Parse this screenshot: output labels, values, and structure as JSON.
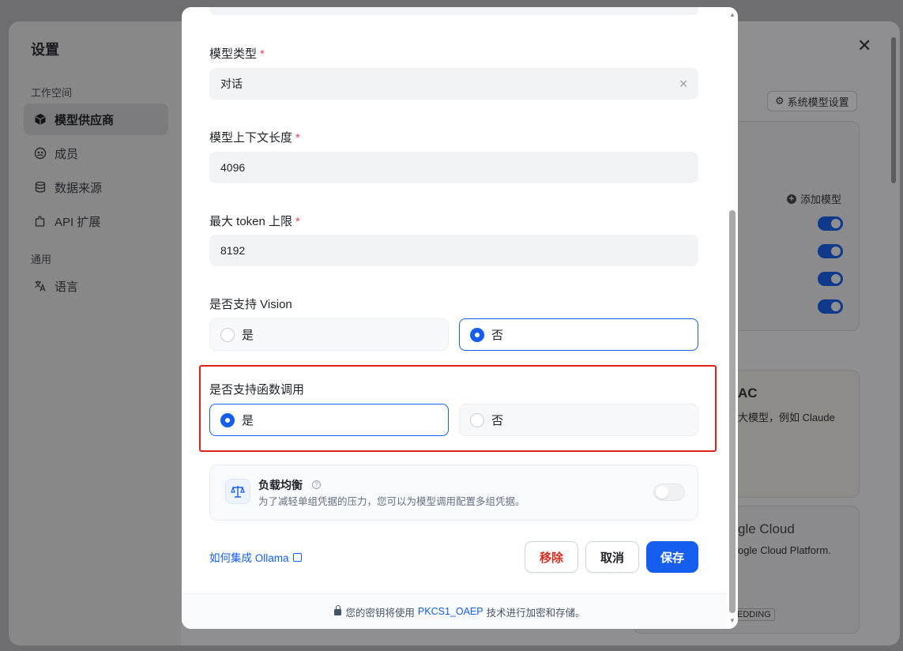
{
  "background": {
    "title": "设置",
    "workspace_label": "工作空间",
    "nav_items": [
      {
        "label": "模型供应商",
        "icon": "cube-icon",
        "active": true
      },
      {
        "label": "成员",
        "icon": "members-icon",
        "active": false
      },
      {
        "label": "数据来源",
        "icon": "database-icon",
        "active": false
      },
      {
        "label": "API 扩展",
        "icon": "puzzle-icon",
        "active": false
      }
    ],
    "general_label": "通用",
    "language_item": "语言",
    "close": "✕",
    "system_model_settings": "系统模型设置",
    "add_model": "添加模型",
    "peek_ac": "AC",
    "peek_claude": "大模型，例如 Claude",
    "peek_gcloud": "gle Cloud",
    "peek_gcp": "ogle Cloud Platform.",
    "peek_embedding": "EDDING"
  },
  "modal": {
    "model_type": {
      "label": "模型类型",
      "required": "*",
      "value": "对话"
    },
    "context_length": {
      "label": "模型上下文长度",
      "required": "*",
      "value": "4096"
    },
    "max_tokens": {
      "label": "最大 token 上限",
      "required": "*",
      "value": "8192"
    },
    "vision": {
      "label": "是否支持 Vision",
      "options": [
        "是",
        "否"
      ],
      "selected": "否"
    },
    "function_call": {
      "label": "是否支持函数调用",
      "options": [
        "是",
        "否"
      ],
      "selected": "是"
    },
    "load_balancing": {
      "title": "负载均衡",
      "help": "?",
      "description": "为了减轻单组凭据的压力，您可以为模型调用配置多组凭据。",
      "enabled": false
    },
    "help_link": "如何集成 Ollama",
    "buttons": {
      "remove": "移除",
      "cancel": "取消",
      "save": "保存"
    },
    "footer": {
      "before": "您的密钥将使用",
      "highlight": "PKCS1_OAEP",
      "after": "技术进行加密和存储。"
    }
  },
  "colors": {
    "accent": "#155eef",
    "danger": "#d92d20",
    "highlight_box": "#e0211c"
  }
}
